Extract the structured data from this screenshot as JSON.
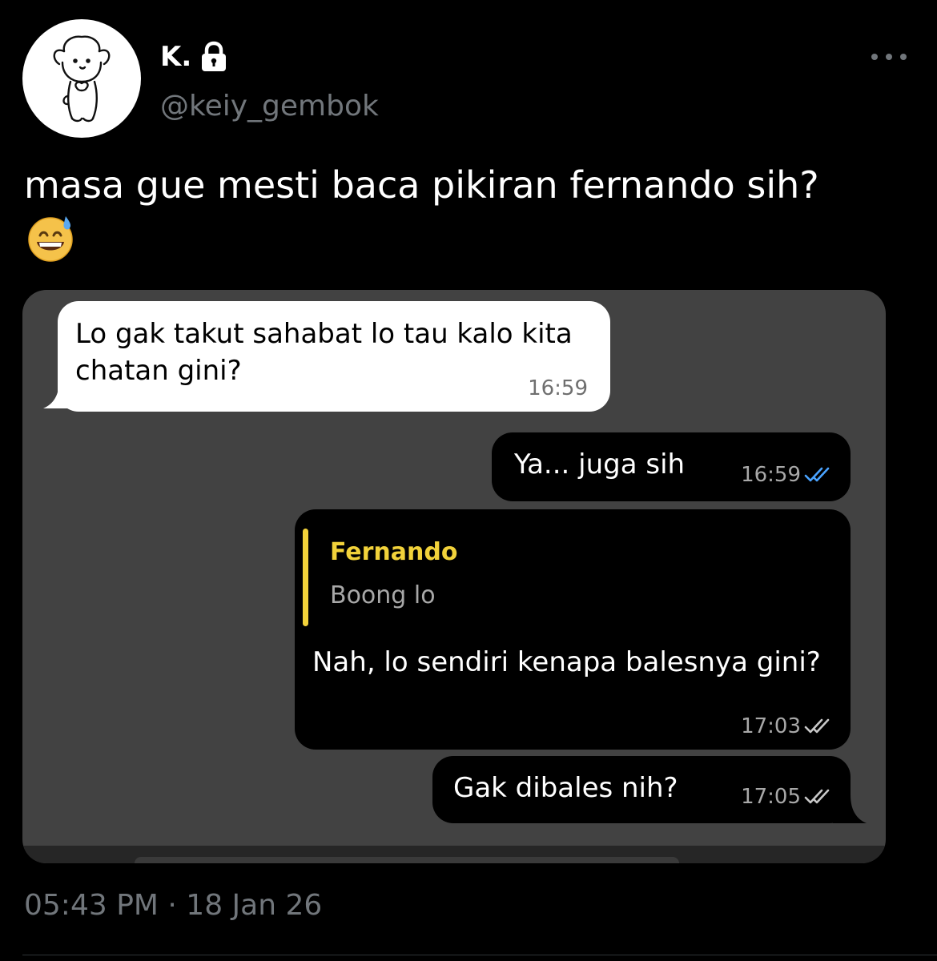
{
  "author": {
    "display_name": "K.",
    "handle": "@keiy_gembok",
    "protected_icon": "lock-icon",
    "avatar_icon": "dog-doodle-avatar"
  },
  "menu_icon": "more-horizontal-icon",
  "tweet": {
    "text": "masa gue mesti baca pikiran fernando sih?",
    "emoji": "grinning-face-with-sweat-emoji",
    "timestamp": "05:43 PM · 18 Jan 26"
  },
  "chat": {
    "messages": [
      {
        "direction": "incoming",
        "text": "Lo gak takut sahabat lo tau kalo kita chatan gini?",
        "time": "16:59"
      },
      {
        "direction": "outgoing",
        "text": "Ya... juga sih",
        "time": "16:59",
        "status": "read"
      },
      {
        "direction": "outgoing",
        "reply_to": {
          "name": "Fernando",
          "text": "Boong lo"
        },
        "text": "Nah, lo sendiri kenapa balesnya gini?",
        "time": "17:03",
        "status": "delivered"
      },
      {
        "direction": "outgoing",
        "text": "Gak dibales nih?",
        "time": "17:05",
        "status": "delivered"
      }
    ]
  },
  "colors": {
    "background": "#000000",
    "secondary_text": "#71767b",
    "chat_background": "#424242",
    "reply_accent": "#f2d23a",
    "read_ticks": "#4aa3ff",
    "delivered_ticks": "#c8c8c8"
  }
}
